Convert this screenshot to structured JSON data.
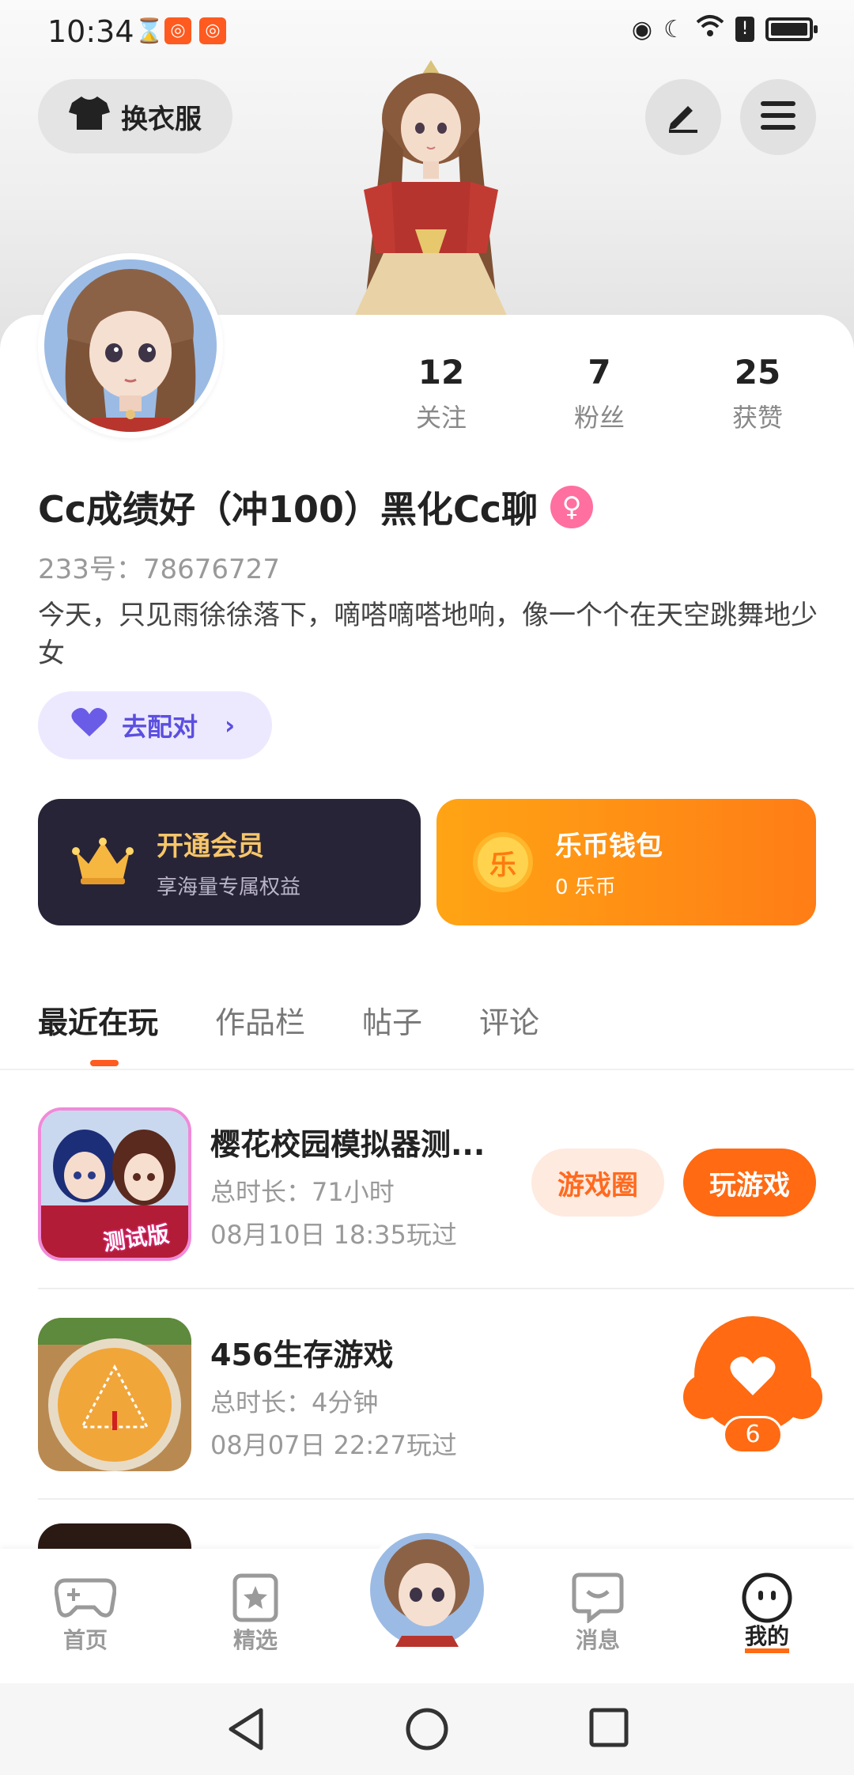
{
  "status_bar": {
    "time": "10:34",
    "icons": [
      "hourglass-icon",
      "app-notification-icon",
      "app-notification-icon",
      "eye-icon",
      "moon-icon",
      "wifi-icon",
      "alert-icon",
      "battery-icon"
    ]
  },
  "header": {
    "dress_up_label": "换衣服",
    "edit_icon": "pencil-icon",
    "menu_icon": "menu-icon"
  },
  "profile": {
    "stats": [
      {
        "value": "12",
        "label": "关注"
      },
      {
        "value": "7",
        "label": "粉丝"
      },
      {
        "value": "25",
        "label": "获赞"
      }
    ],
    "nickname": "Cc成绩好（冲100）黑化Cc聊",
    "gender_icon": "female-icon",
    "gender_color": "#ff6fa0",
    "id_line": "233号：78676727",
    "bio": "今天，只见雨徐徐落下，嘀嗒嘀嗒地响，像一个个在天空跳舞地少女",
    "match_label": "去配对"
  },
  "promos": {
    "vip": {
      "title": "开通会员",
      "subtitle": "享海量专属权益"
    },
    "wallet": {
      "title": "乐币钱包",
      "subtitle": "0 乐币",
      "coin_glyph": "乐"
    }
  },
  "tabs": [
    {
      "label": "最近在玩",
      "active": true
    },
    {
      "label": "作品栏",
      "active": false
    },
    {
      "label": "帖子",
      "active": false
    },
    {
      "label": "评论",
      "active": false
    }
  ],
  "games": [
    {
      "title": "樱花校园模拟器测...",
      "duration": "总时长：71小时",
      "last_played": "08月10日 18:35玩过",
      "icon_badge": "测试版",
      "circle_label": "游戏圈",
      "play_label": "玩游戏"
    },
    {
      "title": "456生存游戏",
      "duration": "总时长：4分钟",
      "last_played": "08月07日 22:27玩过",
      "like_count": "6"
    }
  ],
  "bottom_nav": [
    {
      "label": "首页",
      "icon": "gamepad-icon"
    },
    {
      "label": "精选",
      "icon": "star-bookmark-icon"
    },
    {
      "label": "",
      "icon": "avatar-center"
    },
    {
      "label": "消息",
      "icon": "chat-icon"
    },
    {
      "label": "我的",
      "icon": "face-icon",
      "active": true
    }
  ],
  "colors": {
    "accent": "#ff6a12",
    "vip_bg": "#282438",
    "vip_text": "#f7c66a",
    "match_bg": "#ece9ff",
    "match_text": "#5b4fe0"
  }
}
